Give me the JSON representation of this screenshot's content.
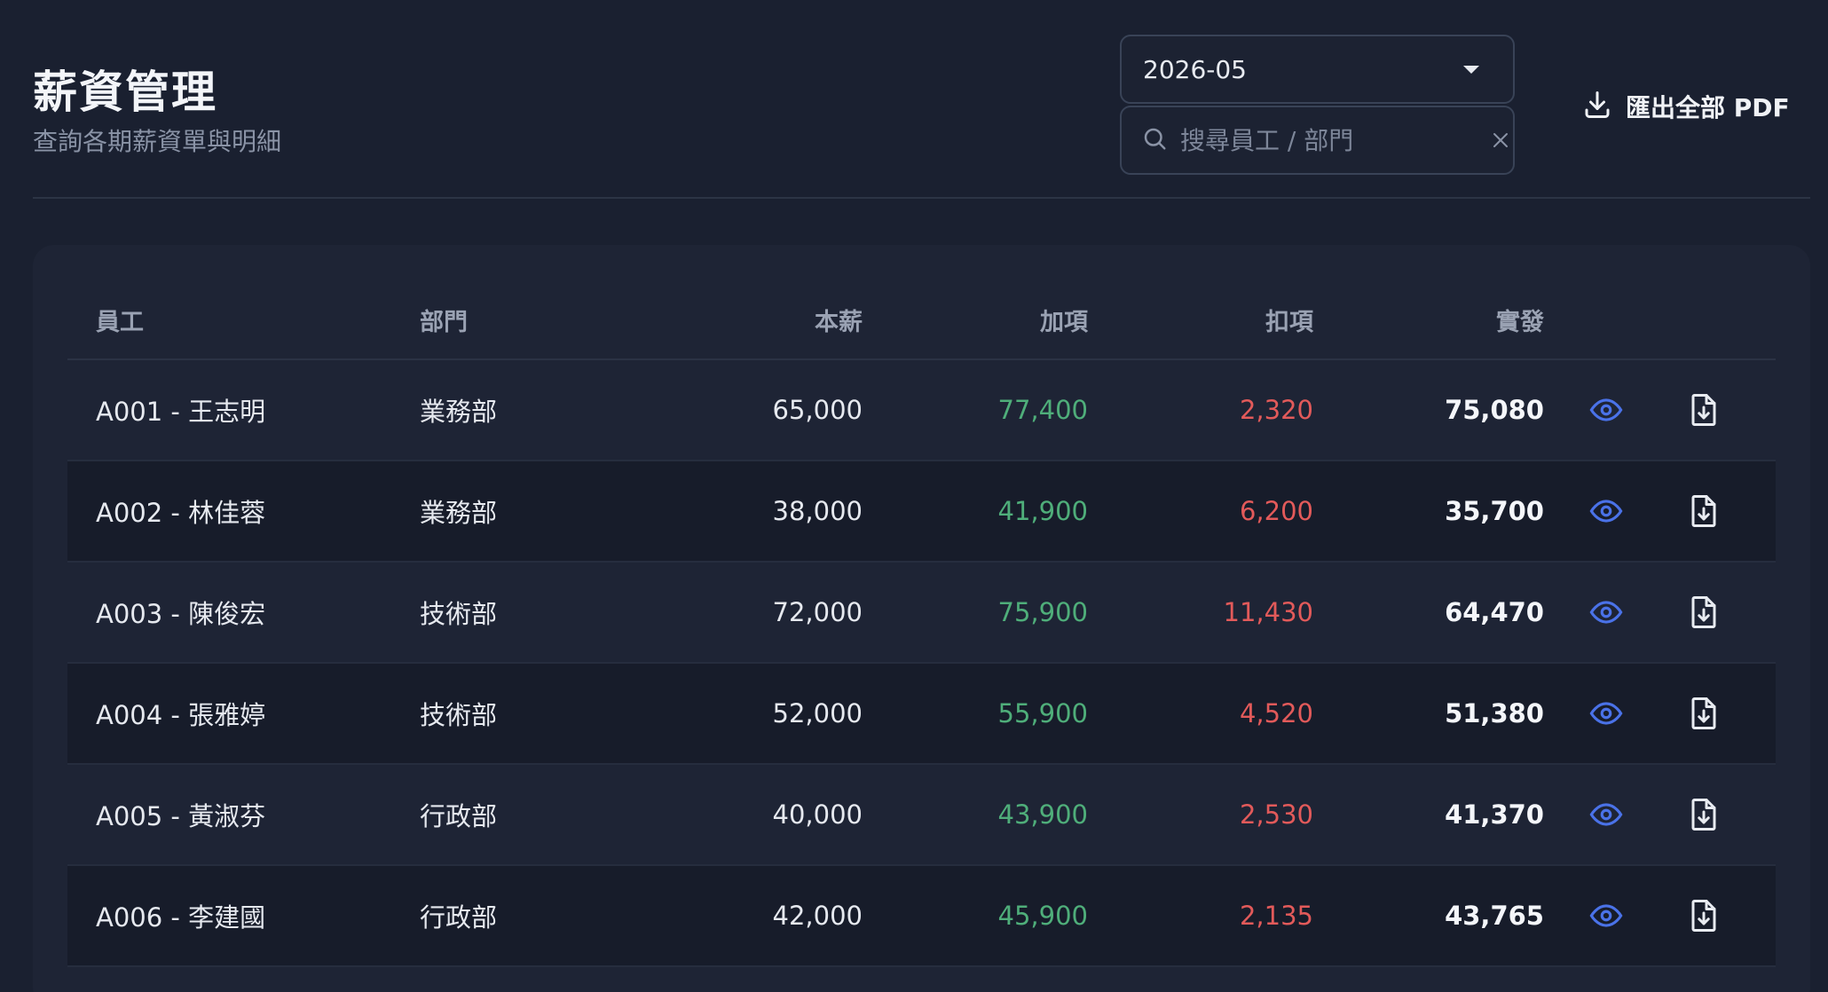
{
  "header": {
    "title": "薪資管理",
    "subtitle": "查詢各期薪資單與明細"
  },
  "filters": {
    "month_value": "2026-05",
    "search_placeholder": "搜尋員工 / 部門",
    "search_value": ""
  },
  "actions": {
    "export_label": "匯出全部 PDF"
  },
  "table": {
    "columns": [
      "員工",
      "部門",
      "本薪",
      "加項",
      "扣項",
      "實發"
    ],
    "rows": [
      {
        "employee": "A001 - 王志明",
        "dept": "業務部",
        "base": "65,000",
        "add": "77,400",
        "deduct": "2,320",
        "net": "75,080"
      },
      {
        "employee": "A002 - 林佳蓉",
        "dept": "業務部",
        "base": "38,000",
        "add": "41,900",
        "deduct": "6,200",
        "net": "35,700"
      },
      {
        "employee": "A003 - 陳俊宏",
        "dept": "技術部",
        "base": "72,000",
        "add": "75,900",
        "deduct": "11,430",
        "net": "64,470"
      },
      {
        "employee": "A004 - 張雅婷",
        "dept": "技術部",
        "base": "52,000",
        "add": "55,900",
        "deduct": "4,520",
        "net": "51,380"
      },
      {
        "employee": "A005 - 黃淑芬",
        "dept": "行政部",
        "base": "40,000",
        "add": "43,900",
        "deduct": "2,530",
        "net": "41,370"
      },
      {
        "employee": "A006 - 李建國",
        "dept": "行政部",
        "base": "42,000",
        "add": "45,900",
        "deduct": "2,135",
        "net": "43,765"
      }
    ]
  },
  "icons": {
    "view": "eye-icon",
    "download_pdf": "file-download-icon",
    "search": "search-icon",
    "clear": "close-icon",
    "export": "download-icon",
    "dropdown": "chevron-down-icon"
  },
  "colors": {
    "background": "#1a2030",
    "card": "#1e2435",
    "add_positive": "#4fae7a",
    "deduct_negative": "#e25a5a",
    "accent_icon": "#4a72e8"
  }
}
